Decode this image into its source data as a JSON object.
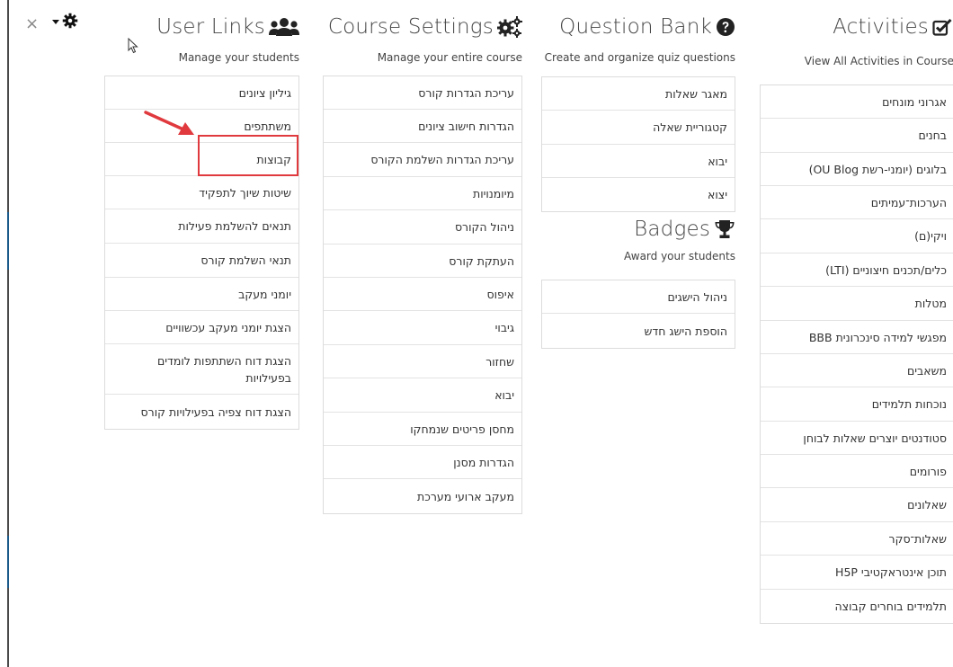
{
  "close_label": "×",
  "icons": {
    "close": "close-icon",
    "settings": "gear-icon",
    "dropdown": "caret-down-icon",
    "user_links": "users-icon",
    "course_settings": "cogs-icon",
    "question_bank": "question-circle-icon",
    "activities": "checkbox-icon",
    "badges": "trophy-icon",
    "pointer": "mouse-cursor-icon",
    "annotation_arrow": "red-arrow-icon"
  },
  "colors": {
    "highlight": "#e0393e",
    "arrow": "#e0393e"
  },
  "columns": {
    "user_links": {
      "title": "User Links",
      "subtitle": "Manage your students",
      "items": [
        "גיליון ציונים",
        "משתתפים",
        "קבוצות",
        "שיטות שיוך לתפקיד",
        "תנאים להשלמת פעילות",
        "תנאי השלמת קורס",
        "יומני מעקב",
        "הצגת יומני מעקב עכשוויים",
        "הצגת דוח השתתפות לומדים בפעילויות",
        "הצגת דוח צפיה בפעילויות קורס"
      ]
    },
    "course_settings": {
      "title": "Course Settings",
      "subtitle": "Manage your entire course",
      "items": [
        "עריכת הגדרות קורס",
        "הגדרות חישוב ציונים",
        "עריכת הגדרות השלמת הקורס",
        "מיומנויות",
        "ניהול הקורס",
        "העתקת קורס",
        "איפוס",
        "גיבוי",
        "שחזור",
        "יבוא",
        "מחסן פריטים שנמחקו",
        "הגדרות מסנן",
        "מעקב ארועי מערכת"
      ]
    },
    "question_bank": {
      "title": "Question Bank",
      "subtitle": "Create and organize quiz questions",
      "items": [
        "מאגר שאלות",
        "קטגוריית שאלה",
        "יבוא",
        "יצוא"
      ]
    },
    "badges": {
      "title": "Badges",
      "subtitle": "Award your students",
      "items": [
        "ניהול הישגים",
        "הוספת הישג חדש"
      ]
    },
    "activities": {
      "title": "Activities",
      "subtitle": "View All Activities in Course",
      "items": [
        "אגרוני מונחים",
        "בחנים",
        "בלוגים (יומני-רשת OU Blog)",
        "הערכות־עמיתים",
        "ויקי(ם)",
        "כלים/תכנים חיצוניים (LTI)",
        "מטלות",
        "מפגשי למידה סינכרונית BBB",
        "משאבים",
        "נוכחות תלמידים",
        "סטודנטים יוצרים שאלות לבוחן",
        "פורומים",
        "שאלונים",
        "שאלות־סקר",
        "תוכן אינטראקטיבי H5P",
        "תלמידים בוחרים קבוצה"
      ]
    }
  }
}
